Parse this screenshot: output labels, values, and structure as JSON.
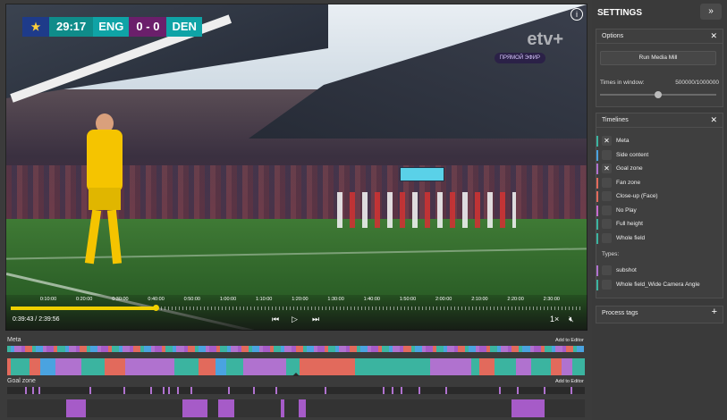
{
  "scoreboard": {
    "time": "29:17",
    "home": "ENG",
    "score": "0 - 0",
    "away": "DEN"
  },
  "broadcaster": {
    "logo_text": "etv+",
    "live_label": "ПРЯМОЙ ЭФИР"
  },
  "player": {
    "ticks": [
      "0:10:00",
      "0:20:00",
      "0:30:00",
      "0:40:00",
      "0:50:00",
      "1:00:00",
      "1:10:00",
      "1:20:00",
      "1:30:00",
      "1:40:00",
      "1:50:00",
      "2:00:00",
      "2:10:00",
      "2:20:00",
      "2:30:00"
    ],
    "progress_fraction": 0.253,
    "time_readout": "0:39:43 / 2:39:56",
    "speed_label": "1×",
    "icons": {
      "prev": "skip-back-icon",
      "play": "play-icon",
      "next": "skip-forward-icon",
      "mute": "mute-icon",
      "info": "info-icon"
    }
  },
  "timelines_area": {
    "meta_label": "Meta",
    "goal_label": "Goal zone",
    "add_to_editor": "Add to Editor",
    "colors": {
      "teal": "#3bb4a0",
      "purple": "#b072cf",
      "salmon": "#e26a5c",
      "blue": "#4aa3e0",
      "lilac": "#a65bc8"
    }
  },
  "sidebar": {
    "title": "SETTINGS",
    "collapse_icon": "double-chevron-right-icon",
    "options": {
      "title": "Options",
      "run_button": "Run Media Mill",
      "times_label": "Times in window:",
      "times_value": "500000/1000000",
      "slider_fraction": 0.5
    },
    "timelines": {
      "title": "Timelines",
      "items": [
        {
          "label": "Meta",
          "checked": true,
          "color": "#3bb4a0"
        },
        {
          "label": "Side content",
          "checked": false,
          "color": "#4aa3e0"
        },
        {
          "label": "Goal zone",
          "checked": true,
          "color": "#b072cf"
        },
        {
          "label": "Fan zone",
          "checked": false,
          "color": "#e26a5c"
        },
        {
          "label": "Close-up (Face)",
          "checked": false,
          "color": "#e26a5c"
        },
        {
          "label": "No Play",
          "checked": false,
          "color": "#c66bd0"
        },
        {
          "label": "Full height",
          "checked": false,
          "color": "#3bb4a0"
        },
        {
          "label": "Whole field",
          "checked": false,
          "color": "#3bb4a0"
        }
      ],
      "types_label": "Types:",
      "types": [
        {
          "label": "subshot",
          "checked": false,
          "color": "#b072cf"
        },
        {
          "label": "Whole field_Wide Camera Angle",
          "checked": false,
          "color": "#3bb4a0"
        }
      ]
    },
    "process_tags": {
      "title": "Process tags",
      "add_icon": "plus-icon"
    }
  }
}
